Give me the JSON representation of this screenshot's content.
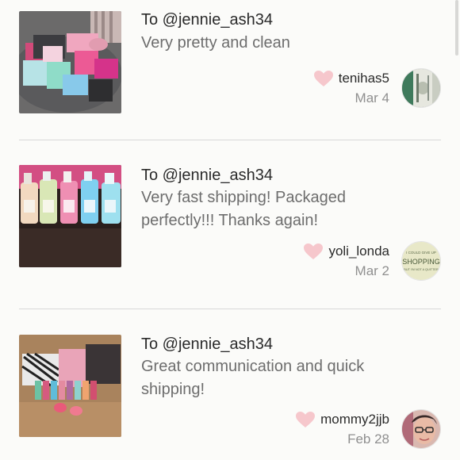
{
  "reviews": [
    {
      "to": "To @jennie_ash34",
      "comment": "Very pretty and clean",
      "username": "tenihas5",
      "date": "Mar 4",
      "thumb_icon": "clothing-photo",
      "avatar_icon": "money-photo"
    },
    {
      "to": "To @jennie_ash34",
      "comment": "Very fast shipping! Packaged perfectly!!! Thanks again!",
      "username": "yoli_londa",
      "date": "Mar 2",
      "thumb_icon": "lotion-bottles-photo",
      "avatar_icon": "shopping-sign-photo",
      "avatar_text": "I COULD GIVE UP SHOPPING BUT I'M NOT A QUITTER"
    },
    {
      "to": "To @jennie_ash34",
      "comment": "Great communication and quick shipping!",
      "username": "mommy2jjb",
      "date": "Feb 28",
      "thumb_icon": "bundle-photo",
      "avatar_icon": "selfie-photo"
    }
  ],
  "colors": {
    "heart": "#f6c7cc",
    "divider": "#d9d9d9",
    "background": "#fbfbf9"
  }
}
